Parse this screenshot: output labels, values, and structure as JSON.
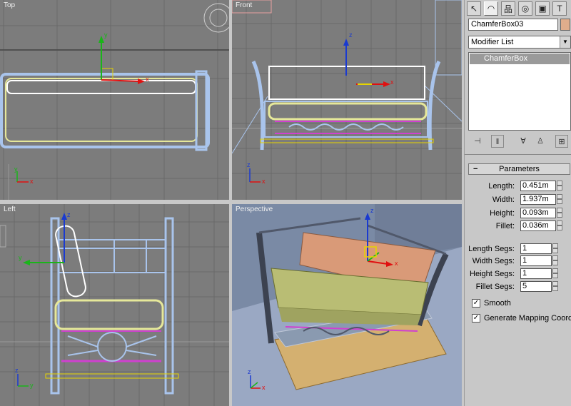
{
  "viewports": {
    "top": {
      "label": "Top"
    },
    "front": {
      "label": "Front"
    },
    "left": {
      "label": "Left"
    },
    "perspective": {
      "label": "Perspective"
    }
  },
  "axes": {
    "x": "x",
    "y": "y",
    "z": "z"
  },
  "command_panel": {
    "tabs": [
      {
        "name": "create-tab-icon",
        "glyph": "↖"
      },
      {
        "name": "modify-tab-icon",
        "glyph": "◠"
      },
      {
        "name": "hierarchy-tab-icon",
        "glyph": "品"
      },
      {
        "name": "motion-tab-icon",
        "glyph": "◎"
      },
      {
        "name": "display-tab-icon",
        "glyph": "▣"
      },
      {
        "name": "utilities-tab-icon",
        "glyph": "T"
      }
    ],
    "object_name": "ChamferBox03",
    "object_color": "#e0ad8c",
    "modifier_list": "Modifier List",
    "stack_items": [
      "ChamferBox"
    ],
    "stack_tools": [
      "pin-stack-icon",
      "show-end-result-icon",
      "make-unique-icon",
      "remove-modifier-icon",
      "configure-sets-icon"
    ],
    "parameters": {
      "title": "Parameters",
      "collapse": "−",
      "length_label": "Length:",
      "length_value": "0.451m",
      "width_label": "Width:",
      "width_value": "1.937m",
      "height_label": "Height:",
      "height_value": "0.093m",
      "fillet_label": "Fillet:",
      "fillet_value": "0.036m",
      "length_segs_label": "Length Segs:",
      "length_segs_value": "1",
      "width_segs_label": "Width Segs:",
      "width_segs_value": "1",
      "height_segs_label": "Height Segs:",
      "height_segs_value": "1",
      "fillet_segs_label": "Fillet Segs:",
      "fillet_segs_value": "5",
      "smooth_label": "Smooth",
      "smooth_checked": "✓",
      "mapping_label": "Generate Mapping Coords.",
      "mapping_checked": "✓"
    }
  }
}
